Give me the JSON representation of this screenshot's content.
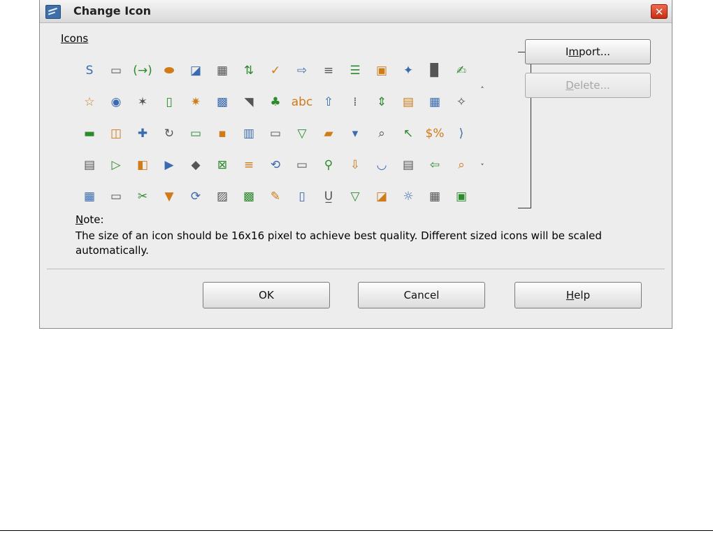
{
  "window": {
    "title": "Change Icon",
    "close_glyph": "✕"
  },
  "icons_section": {
    "label": "Icons"
  },
  "icon_grid": [
    [
      "S",
      "▭",
      "(→)",
      "⬬",
      "◪",
      "▦",
      "⇅",
      "✓",
      "⇨",
      "≡",
      "☰",
      "▣",
      "✦",
      "▉",
      "✍"
    ],
    [
      "☆",
      "◉",
      "✶",
      "▯",
      "✷",
      "▩",
      "◥",
      "♣",
      "abc",
      "⇧",
      "⁞",
      "⇕",
      "▤",
      "▦",
      "✧"
    ],
    [
      "▬",
      "◫",
      "✚",
      "↻",
      "▭",
      "▪",
      "▥",
      "▭",
      "▽",
      "▰",
      "▾",
      "⌕",
      "↖",
      "$%",
      "⟩"
    ],
    [
      "▤",
      "▷",
      "◧",
      "▶",
      "◆",
      "⊠",
      "≡",
      "⟲",
      "▭",
      "⚲",
      "⇩",
      "◡",
      "▤",
      "⇦",
      "⌕"
    ],
    [
      "▦",
      "▭",
      "✂",
      "▼",
      "⟳",
      "▨",
      "▩",
      "✎",
      "▯",
      "U̲",
      "▽",
      "◪",
      "☼",
      "▦",
      "▣"
    ]
  ],
  "scroll": {
    "up_glyph": "˄",
    "down_glyph": "˅"
  },
  "buttons": {
    "import": {
      "prefix": "I",
      "mnemonic": "m",
      "suffix": "port..."
    },
    "delete": {
      "prefix": "",
      "mnemonic": "D",
      "suffix": "elete..."
    },
    "ok": "OK",
    "cancel": "Cancel",
    "help": {
      "prefix": "",
      "mnemonic": "H",
      "suffix": "elp"
    }
  },
  "note": {
    "mnemonic": "N",
    "label_rest": "ote:",
    "text": "The size of an icon should be 16x16 pixel to achieve best quality. Different sized icons will be scaled automatically."
  }
}
